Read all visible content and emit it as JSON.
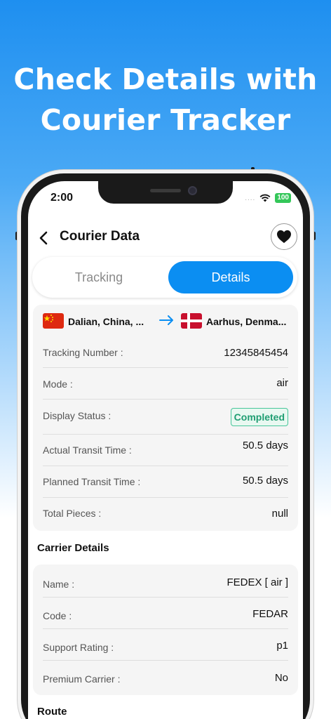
{
  "headline": {
    "line1": "Check Details with",
    "line2": "Courier Tracker"
  },
  "status_bar": {
    "time": "2:00",
    "signal": "....",
    "battery": "100"
  },
  "nav": {
    "title": "Courier Data",
    "back_icon": "chevron-left-icon",
    "favorite_icon": "heart-icon"
  },
  "tabs": [
    {
      "label": "Tracking",
      "active": false
    },
    {
      "label": "Details",
      "active": true
    }
  ],
  "route": {
    "origin": "Dalian, China, ...",
    "destination": "Aarhus, Denma...",
    "arrow_color": "#0b8ef2"
  },
  "details": [
    {
      "label": "Tracking Number :",
      "value": "12345845454"
    },
    {
      "label": "Mode :",
      "value": "air"
    },
    {
      "label": "Display Status :",
      "value": "Completed"
    },
    {
      "label": "Actual Transit Time :",
      "value": "50.5 days"
    },
    {
      "label": "Planned Transit Time :",
      "value": "50.5 days"
    },
    {
      "label": "Total Pieces :",
      "value": "null"
    }
  ],
  "carrier_section": {
    "title": "Carrier Details"
  },
  "carrier": [
    {
      "label": "Name :",
      "value": "FEDEX [ air ]"
    },
    {
      "label": "Code :",
      "value": "FEDAR"
    },
    {
      "label": "Support Rating :",
      "value": "p1"
    },
    {
      "label": "Premium Carrier :",
      "value": "No"
    }
  ],
  "route_section": {
    "title": "Route"
  },
  "colors": {
    "accent": "#0b8ef2",
    "status_green": "#1f9e72",
    "card_bg": "#f5f5f5"
  }
}
